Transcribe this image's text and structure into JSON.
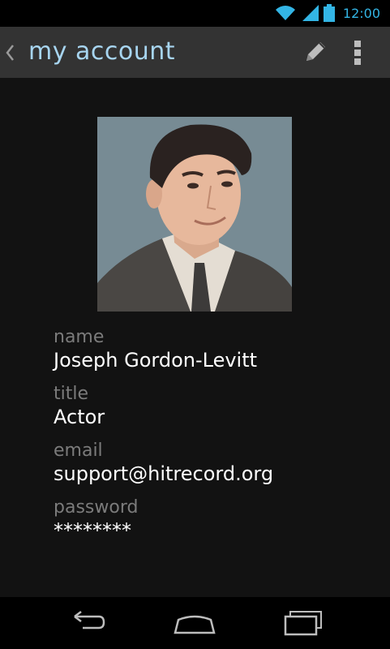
{
  "status_bar": {
    "time": "12:00",
    "icons": [
      "wifi-icon",
      "cell-signal-icon",
      "battery-icon"
    ],
    "accent_color": "#33b5e5"
  },
  "action_bar": {
    "title": "my account",
    "icons": [
      "up-caret-icon",
      "edit-pencil-icon",
      "overflow-menu-icon"
    ]
  },
  "profile": {
    "photo": "profile-photo",
    "fields": [
      {
        "label": "name",
        "value": "Joseph Gordon-Levitt"
      },
      {
        "label": "title",
        "value": "Actor"
      },
      {
        "label": "email",
        "value": "support@hitrecord.org"
      },
      {
        "label": "password",
        "value": "********"
      }
    ]
  },
  "nav_bar": {
    "icons": [
      "back-icon",
      "home-icon",
      "recent-apps-icon"
    ]
  },
  "colors": {
    "title": "#a7d5f0",
    "label": "#7b7b7b",
    "value": "#ffffff",
    "action_bar_bg": "#333333",
    "content_bg": "#121212"
  }
}
